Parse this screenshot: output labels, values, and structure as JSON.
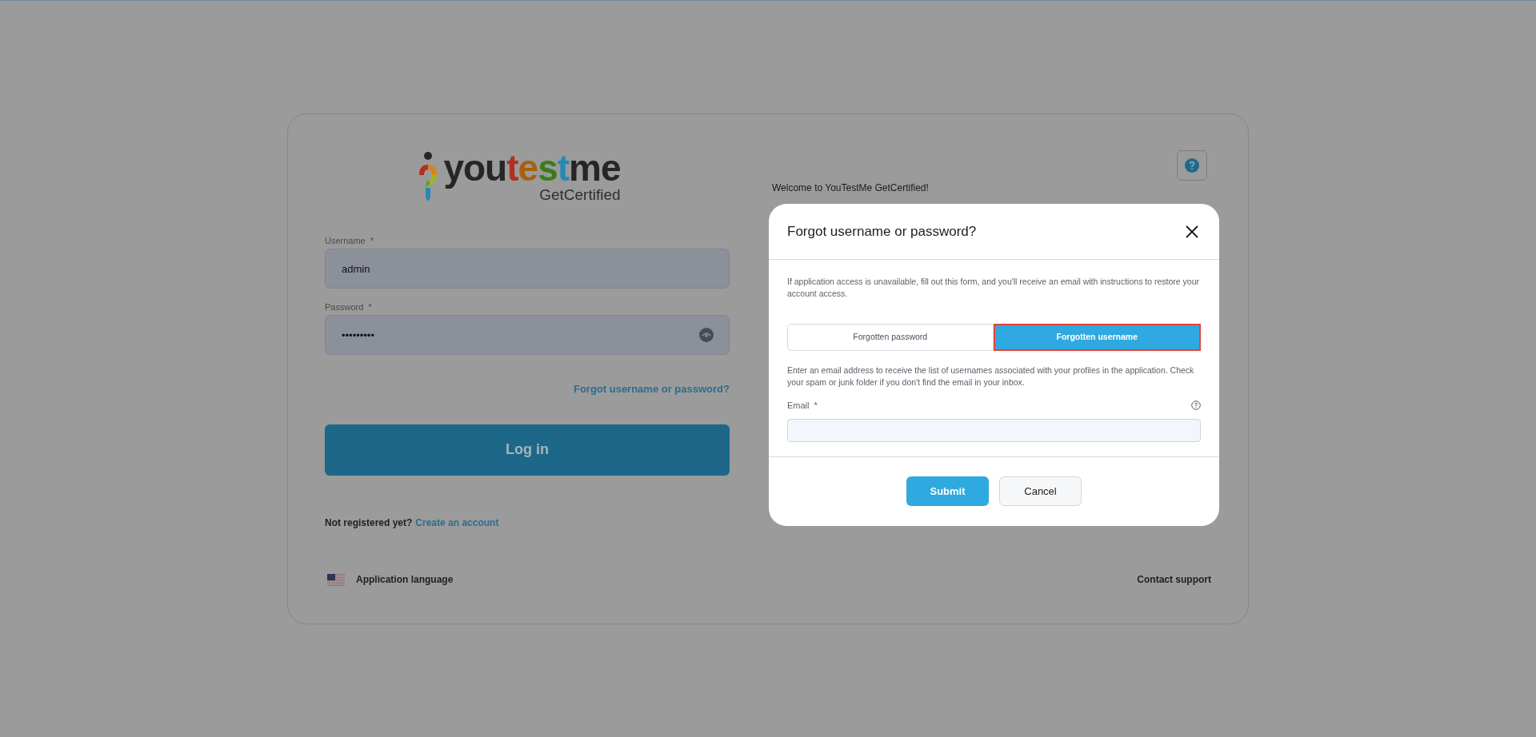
{
  "logo": {
    "parts": [
      {
        "text": "you",
        "color": "#262626"
      },
      {
        "text": "t",
        "color": "#b2301f"
      },
      {
        "text": "e",
        "color": "#a8600e"
      },
      {
        "text": "s",
        "color": "#3a7d18"
      },
      {
        "text": "t",
        "color": "#2789b5"
      },
      {
        "text": "me",
        "color": "#262626"
      }
    ],
    "subtitle": "GetCertified"
  },
  "login_form": {
    "fields": [
      {
        "kind": "text",
        "label": "Username",
        "required_mark": "*",
        "value": "admin"
      },
      {
        "kind": "password",
        "label": "Password",
        "required_mark": "*",
        "value": "•••••••••"
      }
    ],
    "forgot_link": "Forgot username or password?",
    "login_button": "Log in",
    "register_prompt": "Not registered yet?",
    "register_link": "Create an account"
  },
  "welcome": "Welcome to YouTestMe GetCertified!",
  "footer": {
    "language": "Application language",
    "support": "Contact support"
  },
  "dialog": {
    "title": "Forgot username or password?",
    "description": "If application access is unavailable, fill out this form, and you'll receive an email with instructions to restore your account access.",
    "tabs": [
      {
        "label": "Forgotten password",
        "selected": false
      },
      {
        "label": "Forgotten username",
        "selected": true
      }
    ],
    "instructions": "Enter an email address to receive the list of usernames associated with your profiles in the application. Check your spam or junk folder if you don't find the email in your inbox.",
    "email": {
      "label": "Email",
      "required_mark": "*"
    },
    "buttons": [
      {
        "kind": "primary",
        "label": "Submit"
      },
      {
        "kind": "secondary",
        "label": "Cancel"
      }
    ]
  }
}
